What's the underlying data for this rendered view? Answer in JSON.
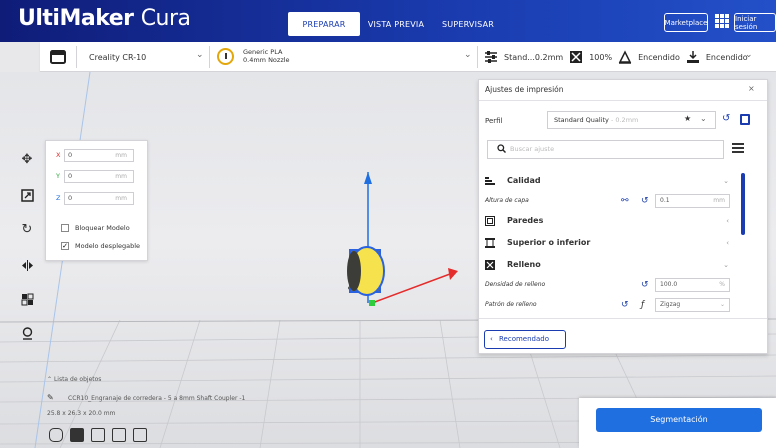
{
  "app": {
    "brand": "UltiMaker",
    "product": "Cura"
  },
  "nav": {
    "tabs": [
      {
        "label": "PREPARAR",
        "active": true
      },
      {
        "label": "VISTA PREVIA"
      },
      {
        "label": "SUPERVISAR"
      }
    ]
  },
  "header_buttons": {
    "marketplace": "Marketplace",
    "signin": "Iniciar sesión"
  },
  "printer": {
    "name": "Creality CR-10",
    "material_line1": "Generic PLA",
    "material_line2": "0.4mm Nozzle"
  },
  "summary": {
    "profile": "Stand...0.2mm",
    "infill": "100%",
    "support": "Encendido",
    "adhesion": "Encendido"
  },
  "transform": {
    "x": {
      "label": "X",
      "value": "0",
      "unit": "mm"
    },
    "y": {
      "label": "Y",
      "value": "0",
      "unit": "mm"
    },
    "z": {
      "label": "Z",
      "value": "0",
      "unit": "mm"
    },
    "lock_model": "Bloquear Modelo",
    "drop_model": "Modelo desplegable"
  },
  "print_settings": {
    "title": "Ajustes de impresión",
    "close": "×",
    "profile_label": "Perfil",
    "profile_value": "Standard Quality",
    "profile_sub": " - 0.2mm",
    "search_placeholder": "Buscar ajuste",
    "categories": {
      "quality": "Calidad",
      "walls": "Paredes",
      "top_bottom": "Superior o inferior",
      "infill": "Relleno"
    },
    "settings": {
      "layer_height": {
        "label": "Altura de capa",
        "value": "0.1",
        "unit": "mm"
      },
      "infill_density": {
        "label": "Densidad de relleno",
        "value": "100.0",
        "unit": "%"
      },
      "infill_pattern": {
        "label": "Patrón de relleno",
        "value": "Zigzag"
      }
    },
    "recommended": "Recomendado"
  },
  "objects": {
    "title": "Lista de objetos",
    "item": "CCR10_Engranaje de corredera - 5 a 8mm Shaft Coupler -1",
    "dims": "25.8 x 26.3 x 20.0 mm"
  },
  "slice_button": "Segmentación",
  "colors": {
    "accent": "#1a3cb0",
    "slice": "#1f6fe0",
    "model": "#f6e24c",
    "material": "#e3a70c"
  }
}
